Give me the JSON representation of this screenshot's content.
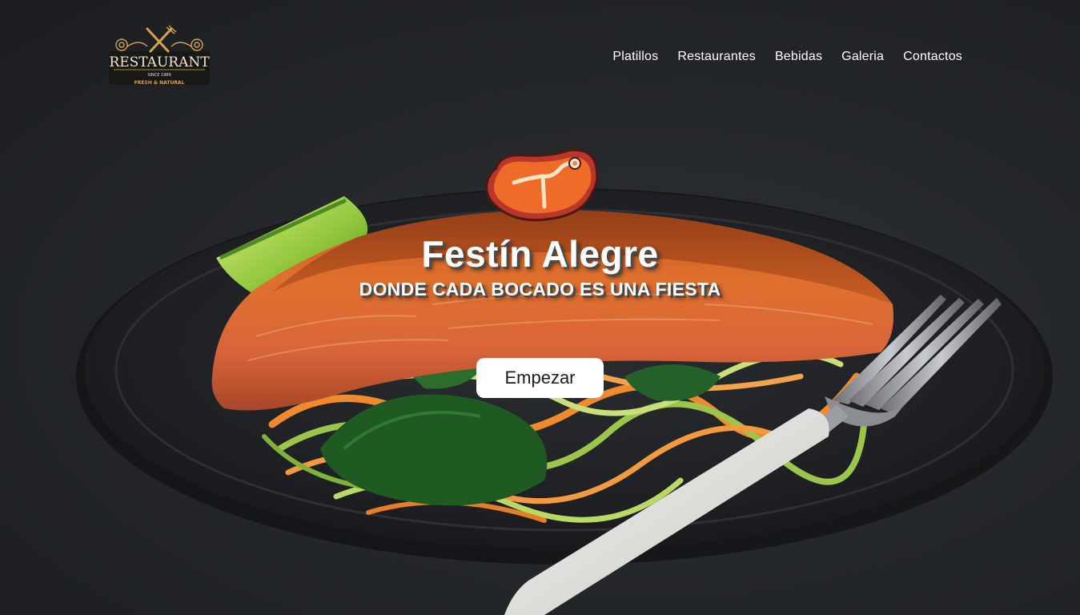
{
  "brand": {
    "logo_word": "RESTAURANT",
    "logo_since": "SINCE 1989",
    "logo_tagline": "FRESH & NATURAL",
    "accent_color": "#d6a24e"
  },
  "nav": {
    "items": [
      {
        "label": "Platillos"
      },
      {
        "label": "Restaurantes"
      },
      {
        "label": "Bebidas"
      },
      {
        "label": "Galeria"
      },
      {
        "label": "Contactos"
      }
    ]
  },
  "hero": {
    "title": "Festín Alegre",
    "subtitle": "DONDE CADA BOCADO ES UNA FIESTA",
    "cta_label": "Empezar",
    "icon": "steak-icon",
    "background": "salmon-dish-photo"
  }
}
